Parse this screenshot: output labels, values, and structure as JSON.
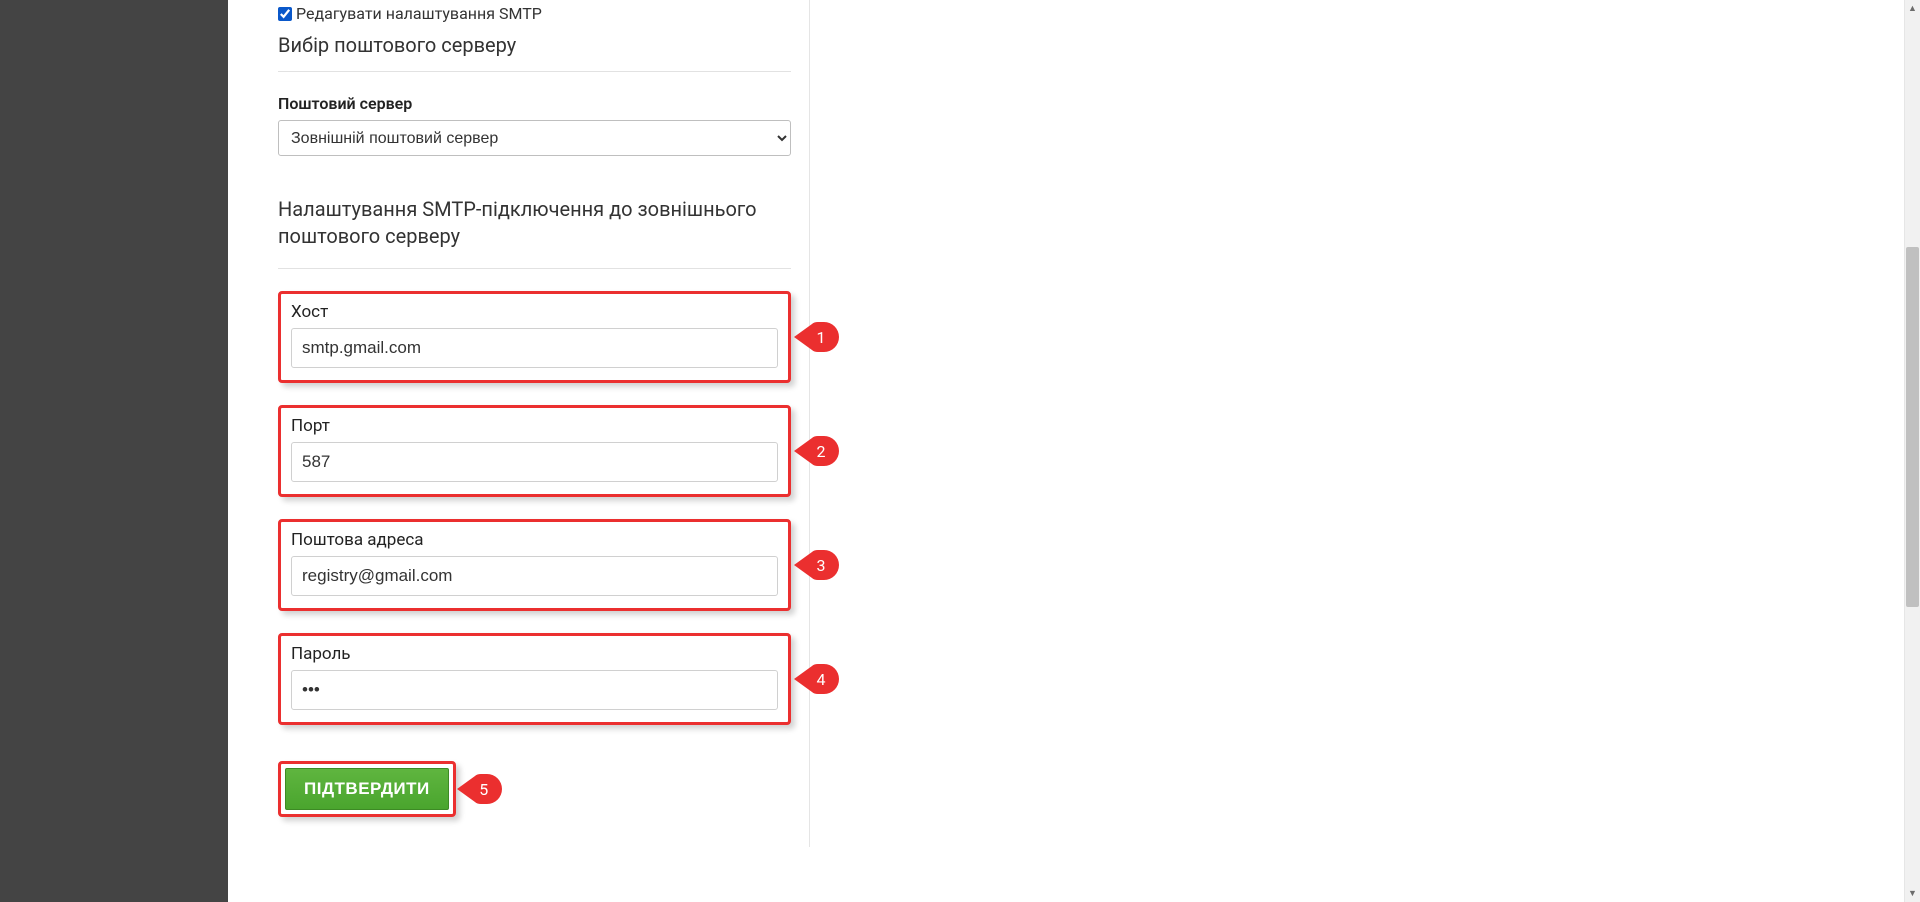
{
  "checkbox": {
    "edit_smtp_label": "Редагувати налаштування SMTP",
    "checked": true
  },
  "section_title_server_choice": "Вибір поштового серверу",
  "mail_server": {
    "label": "Поштовий сервер",
    "selected": "Зовнішній поштовий сервер"
  },
  "section_title_smtp": "Налаштування SMTP-підключення до зовнішнього поштового серверу",
  "fields": {
    "host": {
      "label": "Хост",
      "value": "smtp.gmail.com"
    },
    "port": {
      "label": "Порт",
      "value": "587"
    },
    "email": {
      "label": "Поштова адреса",
      "value": "registry@gmail.com"
    },
    "password": {
      "label": "Пароль",
      "value": "•••"
    }
  },
  "callouts": {
    "host": "1",
    "port": "2",
    "email": "3",
    "password": "4",
    "submit": "5"
  },
  "submit_label": "ПІДТВЕРДИТИ"
}
